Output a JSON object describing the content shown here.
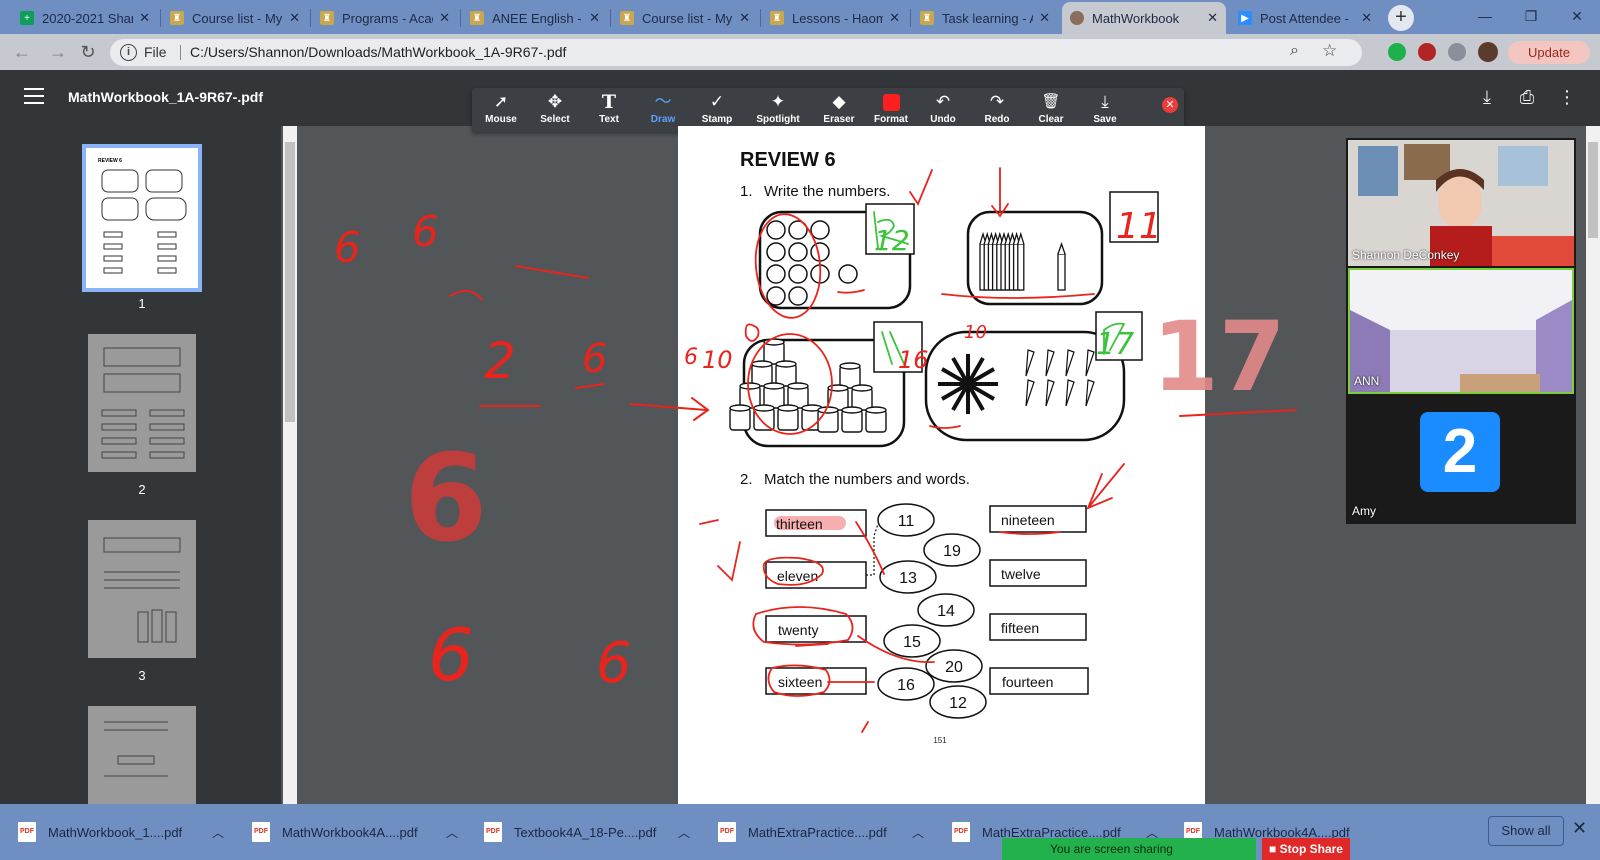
{
  "browser": {
    "tabs": [
      {
        "title": "2020-2021 Shan",
        "favicon": "sheets-icon",
        "color": "#0f9d58"
      },
      {
        "title": "Course list - My",
        "favicon": "school-icon",
        "color": "#c8a74e"
      },
      {
        "title": "Programs - Acad",
        "favicon": "school-icon",
        "color": "#c8a74e"
      },
      {
        "title": "ANEE English - C",
        "favicon": "school-icon",
        "color": "#c8a74e"
      },
      {
        "title": "Course list - My",
        "favicon": "school-icon",
        "color": "#c8a74e"
      },
      {
        "title": "Lessons - Haom",
        "favicon": "school-icon",
        "color": "#c8a74e"
      },
      {
        "title": "Task learning - A",
        "favicon": "school-icon",
        "color": "#c8a74e"
      },
      {
        "title": "MathWorkbook",
        "favicon": "pdf-icon",
        "color": "#8a6d5a"
      },
      {
        "title": "Post Attendee -",
        "favicon": "zoom-icon",
        "color": "#2d8cff"
      }
    ],
    "new_tab": "+",
    "window_controls": {
      "minimize": "—",
      "restore": "❐",
      "close": "✕"
    },
    "address": {
      "label": "File",
      "url": "C:/Users/Shannon/Downloads/MathWorkbook_1A-9R67-.pdf"
    },
    "update_label": "Update"
  },
  "pdf": {
    "title": "MathWorkbook_1A-9R67-.pdf",
    "thumbnails": [
      {
        "page": "1"
      },
      {
        "page": "2"
      },
      {
        "page": "3"
      }
    ]
  },
  "annotation_toolbar": {
    "tools": [
      {
        "label": "Mouse",
        "icon": "cursor-icon",
        "glyph": "➚"
      },
      {
        "label": "Select",
        "icon": "move-icon",
        "glyph": "✥"
      },
      {
        "label": "Text",
        "icon": "text-icon",
        "glyph": "T"
      },
      {
        "label": "Draw",
        "icon": "draw-icon",
        "glyph": "〜"
      },
      {
        "label": "Stamp",
        "icon": "check-icon",
        "glyph": "✓"
      },
      {
        "label": "Spotlight",
        "icon": "spotlight-icon",
        "glyph": "✦"
      },
      {
        "label": "Eraser",
        "icon": "eraser-icon",
        "glyph": "◆"
      },
      {
        "label": "Format",
        "icon": "format-icon",
        "glyph": ""
      },
      {
        "label": "Undo",
        "icon": "undo-icon",
        "glyph": "↶"
      },
      {
        "label": "Redo",
        "icon": "redo-icon",
        "glyph": "↷"
      },
      {
        "label": "Clear",
        "icon": "trash-icon",
        "glyph": "🗑"
      },
      {
        "label": "Save",
        "icon": "save-icon",
        "glyph": "⤓"
      }
    ],
    "active_tool": "Draw",
    "format_color": "#ff1f1f"
  },
  "worksheet": {
    "heading": "REVIEW 6",
    "q1": {
      "number": "1.",
      "text": "Write the numbers."
    },
    "q2": {
      "number": "2.",
      "text": "Match the numbers and words."
    },
    "words_left": [
      "thirteen",
      "eleven",
      "twenty",
      "sixteen"
    ],
    "words_right": [
      "nineteen",
      "twelve",
      "fifteen",
      "fourteen"
    ],
    "numbers": [
      "11",
      "19",
      "13",
      "14",
      "15",
      "20",
      "16",
      "12"
    ],
    "page_footer": "151"
  },
  "handwriting": {
    "box1": "12",
    "box2": "11",
    "box3": "16",
    "box4": "17",
    "label_10a": "10",
    "label_10b": "10",
    "label_6": "6",
    "big_17": "17",
    "canvas_marks": [
      "6",
      "6",
      "2",
      "6",
      "6",
      "6",
      "6"
    ]
  },
  "zoom": {
    "participants": [
      {
        "name": "Shannon DeConkey"
      },
      {
        "name": "ANN"
      },
      {
        "name": "Amy",
        "avatar_text": "2"
      }
    ],
    "sharing_text": "You are screen sharing",
    "stop_label": "Stop Share"
  },
  "downloads": {
    "items": [
      {
        "name": "MathWorkbook_1....pdf"
      },
      {
        "name": "MathWorkbook4A....pdf"
      },
      {
        "name": "Textbook4A_18-Pe....pdf"
      },
      {
        "name": "MathExtraPractice....pdf"
      },
      {
        "name": "MathExtraPractice....pdf"
      },
      {
        "name": "MathWorkbook4A....pdf"
      }
    ],
    "show_all": "Show all"
  },
  "colors": {
    "ink": "#e8241c",
    "highlight": "#f4a0a0",
    "green_ink": "#3cc33c"
  }
}
